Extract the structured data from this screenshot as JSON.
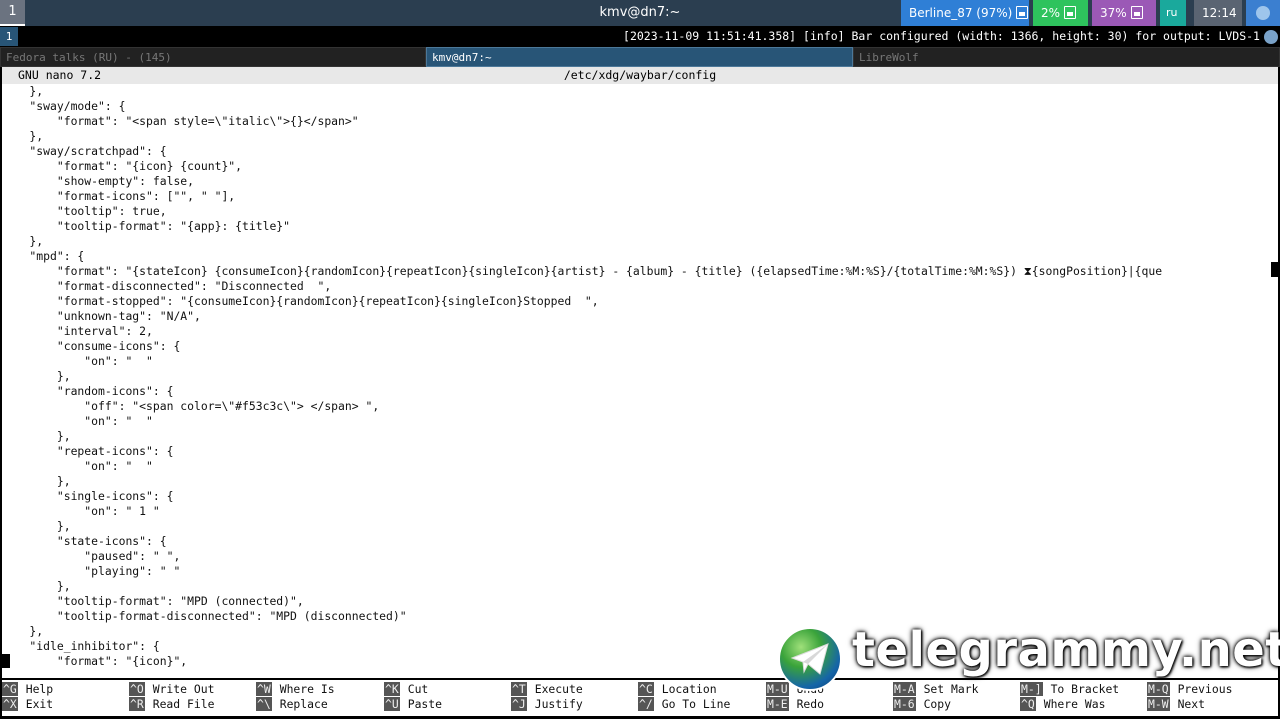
{
  "waybar": {
    "workspace": "1",
    "window_title": "kmv@dn7:~",
    "network": "Berline_87 (97%)",
    "cpu": "2%",
    "memory": "37%",
    "language": "ru",
    "clock": "12:14",
    "colors": {
      "network": "#2f7fd6",
      "cpu": "#2ec35d",
      "memory": "#9b59b6",
      "language": "#1aa99c",
      "clock": "#5a6472",
      "tray": "#3b7fd0"
    }
  },
  "statusline": {
    "workspace": "1",
    "message": "[2023-11-09 11:51:41.358] [info] Bar configured (width: 1366, height: 30) for output: LVDS-1"
  },
  "tabs": [
    {
      "label": "Fedora talks (RU) - (145)",
      "active": false
    },
    {
      "label": "kmv@dn7:~",
      "active": true
    },
    {
      "label": "LibreWolf",
      "active": false
    }
  ],
  "nano": {
    "version": "GNU nano 7.2",
    "filename": "/etc/xdg/waybar/config",
    "lines": [
      "    },",
      "    \"sway/mode\": {",
      "        \"format\": \"<span style=\\\"italic\\\">{}</span>\"",
      "    },",
      "    \"sway/scratchpad\": {",
      "        \"format\": \"{icon} {count}\",",
      "        \"show-empty\": false,",
      "        \"format-icons\": [\"\", \" \"],",
      "        \"tooltip\": true,",
      "        \"tooltip-format\": \"{app}: {title}\"",
      "    },",
      "    \"mpd\": {",
      "        \"format\": \"{stateIcon} {consumeIcon}{randomIcon}{repeatIcon}{singleIcon}{artist} - {album} - {title} ({elapsedTime:%M:%S}/{totalTime:%M:%S}) ⧗{songPosition}|{que",
      "        \"format-disconnected\": \"Disconnected  \",",
      "        \"format-stopped\": \"{consumeIcon}{randomIcon}{repeatIcon}{singleIcon}Stopped  \",",
      "        \"unknown-tag\": \"N/A\",",
      "        \"interval\": 2,",
      "        \"consume-icons\": {",
      "            \"on\": \"  \"",
      "        },",
      "        \"random-icons\": {",
      "            \"off\": \"<span color=\\\"#f53c3c\\\"> </span> \",",
      "            \"on\": \"  \"",
      "        },",
      "        \"repeat-icons\": {",
      "            \"on\": \"  \"",
      "        },",
      "        \"single-icons\": {",
      "            \"on\": \" 1 \"",
      "        },",
      "        \"state-icons\": {",
      "            \"paused\": \" \",",
      "            \"playing\": \" \"",
      "        },",
      "        \"tooltip-format\": \"MPD (connected)\",",
      "        \"tooltip-format-disconnected\": \"MPD (disconnected)\"",
      "    },",
      "    \"idle_inhibitor\": {",
      "        \"format\": \"{icon}\","
    ],
    "shortcuts": [
      {
        "key": "^G",
        "label": "Help"
      },
      {
        "key": "^X",
        "label": "Exit"
      },
      {
        "key": "^O",
        "label": "Write Out"
      },
      {
        "key": "^R",
        "label": "Read File"
      },
      {
        "key": "^W",
        "label": "Where Is"
      },
      {
        "key": "^\\",
        "label": "Replace"
      },
      {
        "key": "^K",
        "label": "Cut"
      },
      {
        "key": "^U",
        "label": "Paste"
      },
      {
        "key": "^T",
        "label": "Execute"
      },
      {
        "key": "^J",
        "label": "Justify"
      },
      {
        "key": "^C",
        "label": "Location"
      },
      {
        "key": "^/",
        "label": "Go To Line"
      },
      {
        "key": "M-U",
        "label": "Undo"
      },
      {
        "key": "M-E",
        "label": "Redo"
      },
      {
        "key": "M-A",
        "label": "Set Mark"
      },
      {
        "key": "M-6",
        "label": "Copy"
      },
      {
        "key": "M-]",
        "label": "To Bracket"
      },
      {
        "key": "^Q",
        "label": "Where Was"
      },
      {
        "key": "M-Q",
        "label": "Previous"
      },
      {
        "key": "M-W",
        "label": "Next"
      }
    ]
  },
  "watermark": {
    "text": "telegrammy.net"
  }
}
